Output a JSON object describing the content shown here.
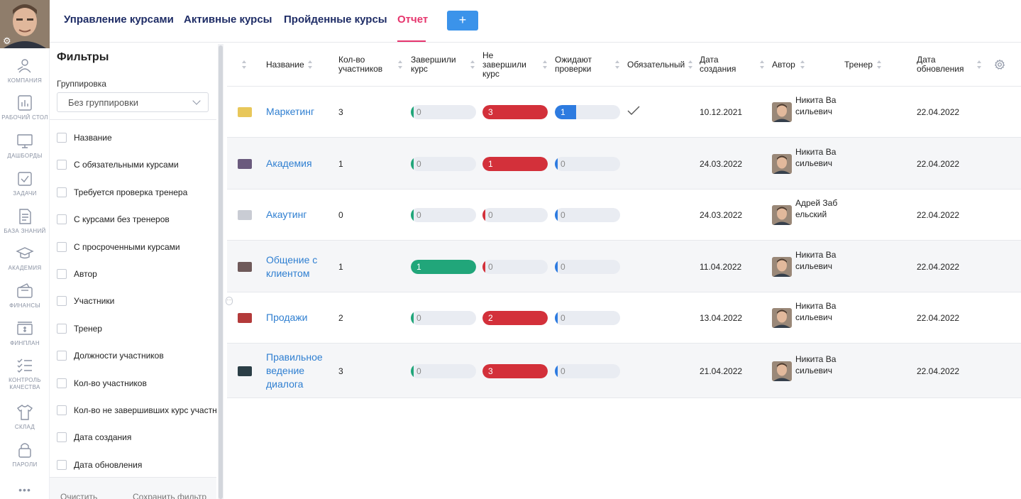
{
  "nav_tabs": [
    "Управление курсами",
    "Активные курсы",
    "Пройденные курсы",
    "Отчет"
  ],
  "add_button": "+",
  "sidebar": {
    "items": [
      {
        "label": "КОМПАНИЯ",
        "icon": "company-icon"
      },
      {
        "label": "РАБОЧИЙ СТОЛ",
        "icon": "desktop-icon"
      },
      {
        "label": "ДАШБОРДЫ",
        "icon": "monitor-icon"
      },
      {
        "label": "ЗАДАЧИ",
        "icon": "checkbox-icon"
      },
      {
        "label": "БАЗА ЗНАНИЙ",
        "icon": "document-icon"
      },
      {
        "label": "АКАДЕМИЯ",
        "icon": "graduation-cap-icon"
      },
      {
        "label": "ФИНАНСЫ",
        "icon": "wallet-icon"
      },
      {
        "label": "ФИНПЛАН",
        "icon": "money-icon"
      },
      {
        "label": "КОНТРОЛЬ КАЧЕСТВА",
        "icon": "checklist-icon"
      },
      {
        "label": "СКЛАД",
        "icon": "tshirt-icon"
      },
      {
        "label": "ПАРОЛИ",
        "icon": "lock-icon"
      }
    ],
    "more": "•••"
  },
  "filters": {
    "title": "Фильтры",
    "grouping_label": "Группировка",
    "grouping_value": "Без группировки",
    "options": [
      "Название",
      "С обязательными курсами",
      "Требуется проверка тренера",
      "С курсами без тренеров",
      "С просроченными курсами",
      "Автор",
      "Участники",
      "Тренер",
      "Должности участников",
      "Кол-во участников",
      "Кол-во не завершивших курс участн",
      "Дата создания",
      "Дата обновления"
    ],
    "clear_label": "Очистить",
    "save_label": "Сохранить фильтр"
  },
  "table": {
    "columns": [
      "Название",
      "Кол-во участников",
      "Завершили курс",
      "Не завершили курс",
      "Ожидают проверки",
      "Обязательный",
      "Дата создания",
      "Автор",
      "Тренер",
      "Дата обновления"
    ],
    "colors": {
      "completed": "#21a67a",
      "not_completed": "#d3303a",
      "pending": "#2d7be0",
      "zero_bg": "#e9ecf2"
    },
    "rows": [
      {
        "name": "Маркетинг",
        "members": "3",
        "completed": 0,
        "not_completed": 3,
        "pending": 1,
        "mandatory": true,
        "created": "10.12.2021",
        "author": "Никита Васильевич",
        "trainer": "",
        "updated": "22.04.2022"
      },
      {
        "name": "Академия",
        "members": "1",
        "completed": 0,
        "not_completed": 1,
        "pending": 0,
        "mandatory": false,
        "created": "24.03.2022",
        "author": "Никита Васильевич",
        "trainer": "",
        "updated": "22.04.2022"
      },
      {
        "name": "Акаутинг",
        "members": "0",
        "completed": 0,
        "not_completed": 0,
        "pending": 0,
        "mandatory": false,
        "created": "24.03.2022",
        "author": "Адрей Забельский",
        "trainer": "",
        "updated": "22.04.2022"
      },
      {
        "name": "Общение с клиентом",
        "members": "1",
        "completed": 1,
        "not_completed": 0,
        "pending": 0,
        "mandatory": false,
        "created": "11.04.2022",
        "author": "Никита Васильевич",
        "trainer": "",
        "updated": "22.04.2022"
      },
      {
        "name": "Продажи",
        "members": "2",
        "completed": 0,
        "not_completed": 2,
        "pending": 0,
        "mandatory": false,
        "created": "13.04.2022",
        "author": "Никита Васильевич",
        "trainer": "",
        "updated": "22.04.2022"
      },
      {
        "name": "Правильное ведение диалога",
        "members": "3",
        "completed": 0,
        "not_completed": 3,
        "pending": 0,
        "mandatory": false,
        "created": "21.04.2022",
        "author": "Никита Васильевич",
        "trainer": "",
        "updated": "22.04.2022"
      }
    ]
  }
}
